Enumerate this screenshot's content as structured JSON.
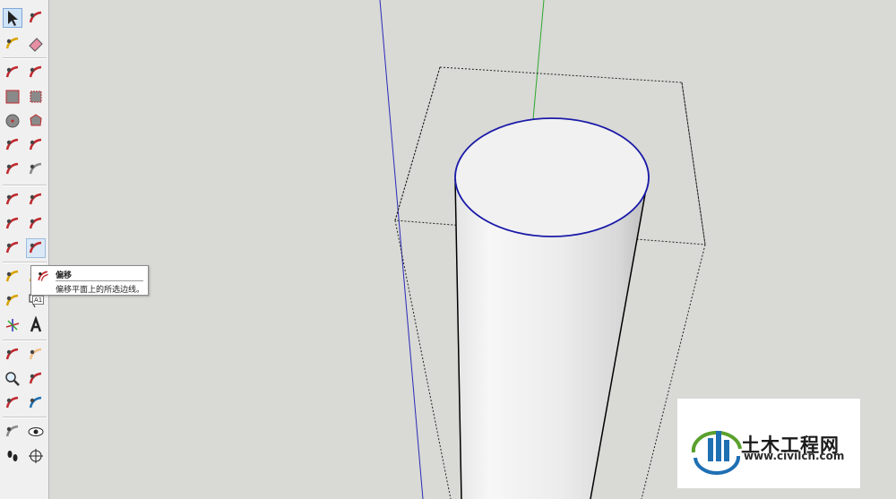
{
  "toolbar": {
    "tools": [
      {
        "name": "select-arrow-icon",
        "color": "#222222"
      },
      {
        "name": "make-component-icon",
        "color": "#c0282d"
      },
      {
        "name": "paint-bucket-icon",
        "color": "#d9a400"
      },
      {
        "name": "eraser-icon",
        "color": "#e78fa4"
      },
      {
        "name": "pencil-line-icon",
        "color": "#c0282d"
      },
      {
        "name": "freehand-icon",
        "color": "#c0282d"
      },
      {
        "name": "rectangle-icon",
        "color": "#8a8a8a"
      },
      {
        "name": "rotated-rectangle-icon",
        "color": "#8a8a8a"
      },
      {
        "name": "circle-icon",
        "color": "#8a8a8a"
      },
      {
        "name": "polygon-icon",
        "color": "#8a8a8a"
      },
      {
        "name": "arc-icon",
        "color": "#c0282d"
      },
      {
        "name": "two-point-arc-icon",
        "color": "#c0282d"
      },
      {
        "name": "three-point-arc-icon",
        "color": "#c0282d"
      },
      {
        "name": "pie-icon",
        "color": "#8a8a8a"
      },
      {
        "name": "move-icon",
        "color": "#c0282d"
      },
      {
        "name": "push-pull-icon",
        "color": "#c0282d"
      },
      {
        "name": "rotate-icon",
        "color": "#c0282d"
      },
      {
        "name": "follow-me-icon",
        "color": "#c0282d"
      },
      {
        "name": "scale-icon",
        "color": "#c0282d"
      },
      {
        "name": "offset-icon",
        "color": "#c0282d"
      },
      {
        "name": "tape-measure-icon",
        "color": "#d9a400"
      },
      {
        "name": "dimension-icon",
        "color": "#d9a400"
      },
      {
        "name": "protractor-icon",
        "color": "#d9a400"
      },
      {
        "name": "text-label-icon",
        "color": "#222222"
      },
      {
        "name": "axes-icon",
        "color": "#c0282d"
      },
      {
        "name": "3d-text-icon",
        "color": "#222222"
      },
      {
        "name": "orbit-icon",
        "color": "#c0282d"
      },
      {
        "name": "pan-icon",
        "color": "#f2c08a"
      },
      {
        "name": "zoom-icon",
        "color": "#1f6fb3"
      },
      {
        "name": "zoom-window-icon",
        "color": "#c0282d"
      },
      {
        "name": "zoom-extents-icon",
        "color": "#c0282d"
      },
      {
        "name": "previous-view-icon",
        "color": "#1f6fb3"
      },
      {
        "name": "position-camera-icon",
        "color": "#8a8a8a"
      },
      {
        "name": "look-around-icon",
        "color": "#222222"
      },
      {
        "name": "walk-icon",
        "color": "#222222"
      },
      {
        "name": "section-plane-icon",
        "color": "#222222"
      }
    ]
  },
  "tooltip": {
    "title": "偏移",
    "description": "偏移平面上的所选边线。",
    "badge": "A1"
  },
  "viewport": {
    "background": "#d9d9d6",
    "blue_axis_color": "#2a2ab8",
    "green_axis_color": "#2ca82c",
    "edge_color": "#000000",
    "selected_edge_color": "#1a1aa8"
  },
  "watermark": {
    "title": "土木工程网",
    "url": "www.civilcn.com",
    "logo_blue": "#1f6fb3",
    "logo_green": "#5aa02c"
  }
}
